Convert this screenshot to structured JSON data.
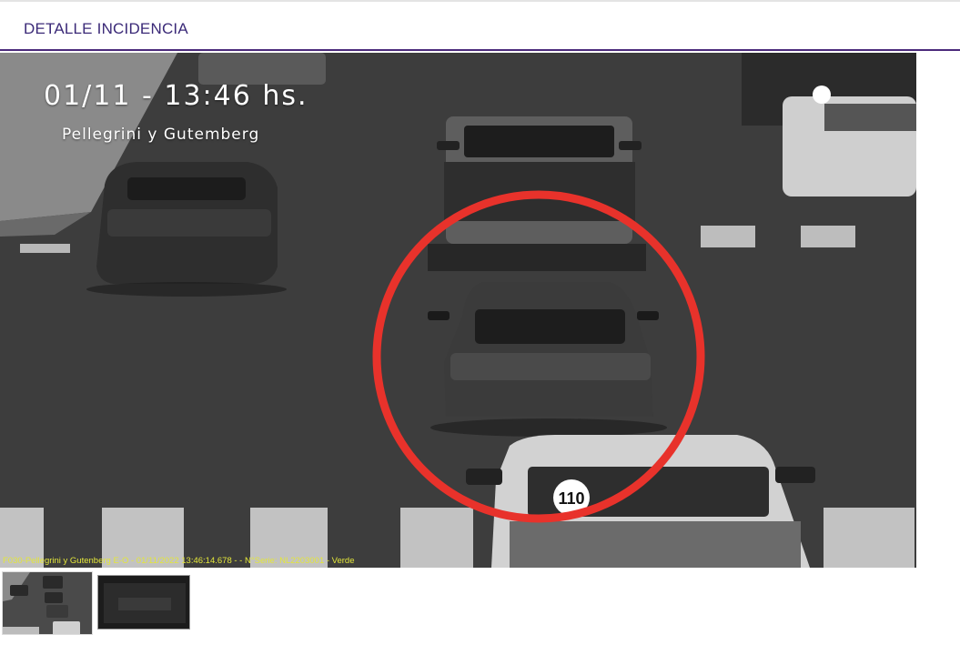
{
  "header": {
    "title": "DETALLE INCIDENCIA"
  },
  "photo": {
    "datetime": "01/11 - 13:46 hs.",
    "location": "Pellegrini y Gutemberg",
    "caption": "F030-Pellegrini y Gutenberg E-O - 01/11/2022 13:46:14.678 - - N°Serie: NL2203001 - Verde",
    "plate_sign": "110",
    "highlight_color": "#e8322b"
  },
  "thumbnails": [
    {
      "label": "scene"
    },
    {
      "label": "plate"
    }
  ],
  "colors": {
    "header_text": "#3b2a78",
    "header_border": "#4b2a7b",
    "caption_text": "#e3e63a"
  }
}
